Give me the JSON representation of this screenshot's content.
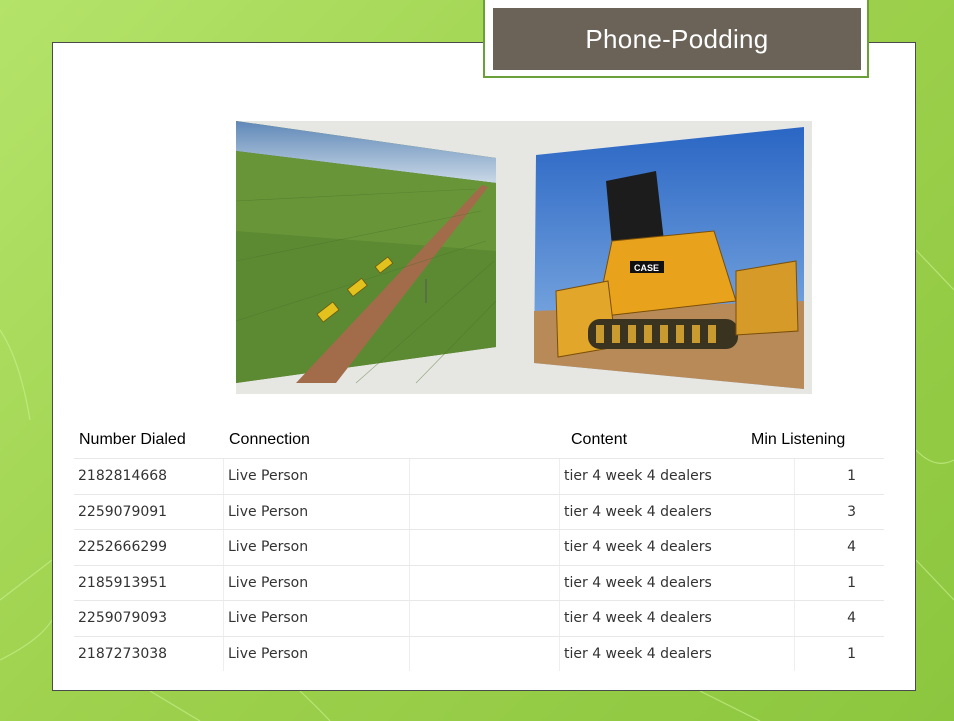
{
  "slide": {
    "title": "Phone-Podding"
  },
  "images": [
    {
      "icon": "aerial-harvester-field-photo"
    },
    {
      "icon": "case-bulldozer-photo",
      "logo_text": "CASE"
    }
  ],
  "table": {
    "headers": [
      "Number Dialed",
      "Connection",
      "Content",
      "Min Listening"
    ],
    "rows": [
      {
        "number": "2182814668",
        "connection": "Live Person",
        "content": "tier 4 week 4 dealers",
        "minutes": "1"
      },
      {
        "number": "2259079091",
        "connection": "Live Person",
        "content": "tier 4 week 4 dealers",
        "minutes": "3"
      },
      {
        "number": "2252666299",
        "connection": "Live Person",
        "content": "tier 4 week 4 dealers",
        "minutes": "4"
      },
      {
        "number": "2185913951",
        "connection": "Live Person",
        "content": "tier 4 week 4 dealers",
        "minutes": "1"
      },
      {
        "number": "2259079093",
        "connection": "Live Person",
        "content": "tier 4 week 4 dealers",
        "minutes": "4"
      },
      {
        "number": "2187273038",
        "connection": "Live Person",
        "content": "tier 4 week 4 dealers",
        "minutes": "1"
      }
    ]
  },
  "colors": {
    "background": "#9fd24e",
    "title_fill": "#6b6358",
    "title_border": "#6aa03a"
  }
}
